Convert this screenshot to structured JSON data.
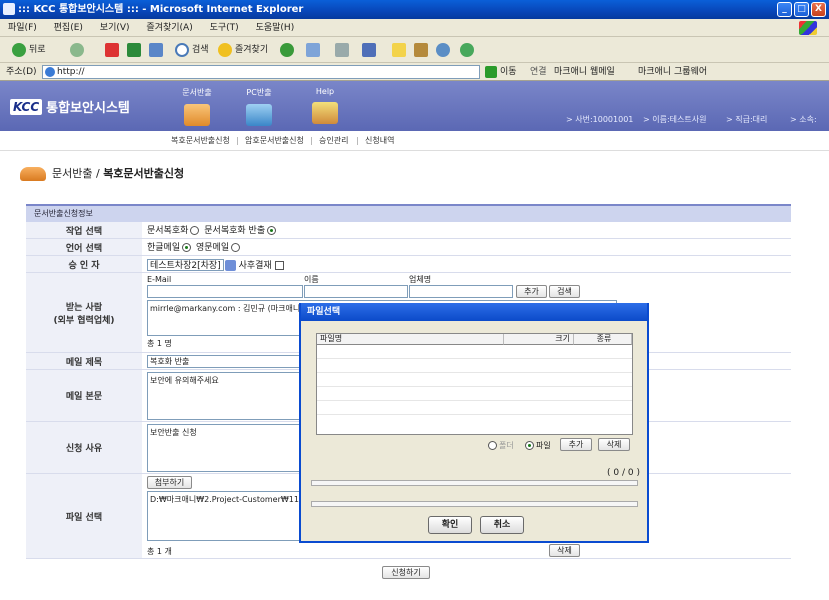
{
  "window": {
    "title": "::: KCC 통합보안시스템 ::: - Microsoft Internet Explorer",
    "minimize": "_",
    "maximize": "□",
    "close": "X"
  },
  "menubar": [
    "파일(F)",
    "편집(E)",
    "보기(V)",
    "즐겨찾기(A)",
    "도구(T)",
    "도움말(H)"
  ],
  "toolbar": {
    "back": "뒤로",
    "search": "검색",
    "favorites": "즐겨찾기"
  },
  "addressbar": {
    "label": "주소(D)",
    "url": "http://",
    "go": "이동",
    "links_label": "연결",
    "link1": "마크애니 웹메일",
    "link2": "마크애니 그룹웨어"
  },
  "header": {
    "logo_text": "KCC",
    "brand": "통합보안시스템",
    "nav": [
      "문서반출",
      "PC반출",
      "Help"
    ],
    "user": {
      "employee_no": "> 사번:10001001",
      "name": "> 이름:테스트사원",
      "rank": "> 직급:대리",
      "dept": "> 소속:"
    }
  },
  "subnav": [
    "복호문서반출신청",
    "|",
    "암호문서반출신청",
    "|",
    "승인관리",
    "|",
    "신청내역"
  ],
  "page": {
    "section": "문서반출",
    "sep": " / ",
    "title": "복호문서반출신청"
  },
  "form": {
    "title": "문서반출신청정보",
    "work": {
      "label": "작업 선택",
      "opt1": "문서복호화",
      "opt2": "문서복호화 반출"
    },
    "lang": {
      "label": "언어 선택",
      "opt1": "한글메일",
      "opt2": "영문메일"
    },
    "approver": {
      "label": "승 인 자",
      "value": "테스트차장2[차장]",
      "post": "사후결재"
    },
    "recipient": {
      "label": "받는 사람",
      "label2": "(외부 협력업체)",
      "col_email": "E-Mail",
      "col_name": "이름",
      "col_company": "업체명",
      "add": "추가",
      "search": "검색",
      "entry": "mirrle@markany.com : 김민규 (마크애니)",
      "count": "총 1 명"
    },
    "mail_subject": {
      "label": "메일 제목",
      "value": "복호화 반출"
    },
    "mail_body": {
      "label": "메일 본문",
      "value": "보안에 유의해주세요"
    },
    "reason": {
      "label": "신청 사유",
      "value": "보안반출 신청"
    },
    "file": {
      "label": "파일 선택",
      "attach": "첨부하기",
      "path": "D:₩마크애니₩2.Project-Customer₩11.한",
      "count": "총 1 개",
      "delete": "삭제"
    },
    "submit": "신청하기"
  },
  "modal": {
    "title": "파일선택",
    "col_name": "파일명",
    "col_size": "크기",
    "col_type": "종류",
    "opt_folder": "폴더",
    "opt_file": "파일",
    "add": "추가",
    "delete": "삭제",
    "counter": "( 0 / 0 )",
    "ok": "확인",
    "cancel": "취소"
  }
}
